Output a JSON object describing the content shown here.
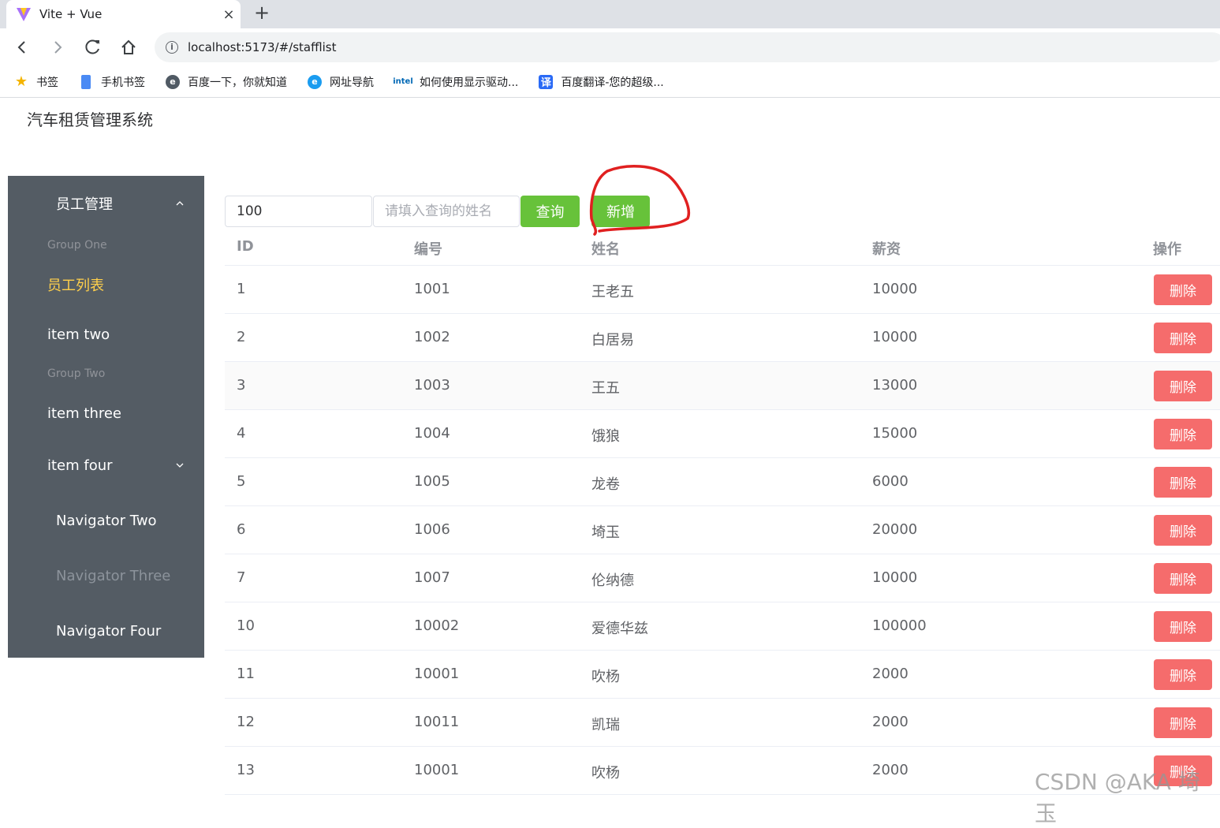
{
  "browser": {
    "tab_title": "Vite + Vue",
    "tab_close": "×",
    "new_tab": "+",
    "url": "localhost:5173/#/stafflist",
    "bookmarks": [
      {
        "label": "书签",
        "icon": "star-icon"
      },
      {
        "label": "手机书签",
        "icon": "phone-icon"
      },
      {
        "label": "百度一下，你就知道",
        "icon": "e-icon"
      },
      {
        "label": "网址导航",
        "icon": "ie-icon"
      },
      {
        "label": "如何使用显示驱动...",
        "icon": "intel-icon"
      },
      {
        "label": "百度翻译-您的超级...",
        "icon": "translate-icon"
      }
    ],
    "intel_text": "intel",
    "translate_char": "译"
  },
  "app": {
    "title": "汽车租赁管理系统"
  },
  "sidebar": {
    "menu_title": "员工管理",
    "group_one": "Group One",
    "item_active": "员工列表",
    "item_two": "item two",
    "group_two": "Group Two",
    "item_three": "item three",
    "item_four": "item four",
    "nav_two": "Navigator Two",
    "nav_three": "Navigator Three",
    "nav_four": "Navigator Four"
  },
  "toolbar": {
    "id_value": "100",
    "name_placeholder": "请填入查询的姓名",
    "query_label": "查询",
    "add_label": "新增"
  },
  "table": {
    "headers": [
      "ID",
      "编号",
      "姓名",
      "薪资",
      "操作"
    ],
    "delete_label": "删除",
    "rows": [
      [
        "1",
        "1001",
        "王老五",
        "10000"
      ],
      [
        "2",
        "1002",
        "白居易",
        "10000"
      ],
      [
        "3",
        "1003",
        "王五",
        "13000"
      ],
      [
        "4",
        "1004",
        "饿狼",
        "15000"
      ],
      [
        "5",
        "1005",
        "龙卷",
        "6000"
      ],
      [
        "6",
        "1006",
        "埼玉",
        "20000"
      ],
      [
        "7",
        "1007",
        "伦纳德",
        "10000"
      ],
      [
        "10",
        "10002",
        "爱德华兹",
        "100000"
      ],
      [
        "11",
        "10001",
        "吹杨",
        "2000"
      ],
      [
        "12",
        "10011",
        "凯瑞",
        "2000"
      ],
      [
        "13",
        "10001",
        "吹杨",
        "2000"
      ]
    ]
  },
  "watermark": "CSDN @AKA 埼玉",
  "colors": {
    "sidebar_bg": "#545c64",
    "active_text": "#ffd04b",
    "green": "#67c23a",
    "danger": "#f56c6c",
    "annotation": "#e02020"
  }
}
